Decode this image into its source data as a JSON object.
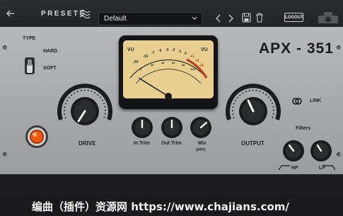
{
  "topbar": {
    "presets_label": "PRESETS",
    "preset_value": "Default",
    "logout_label": "LOGOUT"
  },
  "plugin": {
    "model": "APX - 351",
    "type_label": "TYPE",
    "type_hard": "HARD",
    "type_soft": "SOFT",
    "drive_label": "DRIVE",
    "output_label": "OUTPUT",
    "in_trim_label": "In Trim",
    "out_trim_label": "Out Trim",
    "mix_label": "Mix",
    "mix_sub": "(DRY)",
    "link_label": "LINK",
    "filters_label": "Filters",
    "hp_label": "HP",
    "lp_label": "LP"
  },
  "meter": {
    "vu_left": "VU",
    "vu_right": "VU",
    "scale": [
      "-20",
      "-10",
      "-7",
      "-5",
      "-3",
      "-2",
      "-1",
      "0",
      "+1",
      "+2",
      "+3"
    ],
    "lower_scale": [
      "0",
      "20",
      "40",
      "60",
      "80",
      "100"
    ]
  },
  "watermark": {
    "text": "编曲（插件）资源网   https://www.chajians.com/"
  },
  "colors": {
    "panel": "#aeb0b2",
    "meter_face": "#e8cf8f",
    "lamp": "#f25a12",
    "topbar": "#27282b"
  }
}
